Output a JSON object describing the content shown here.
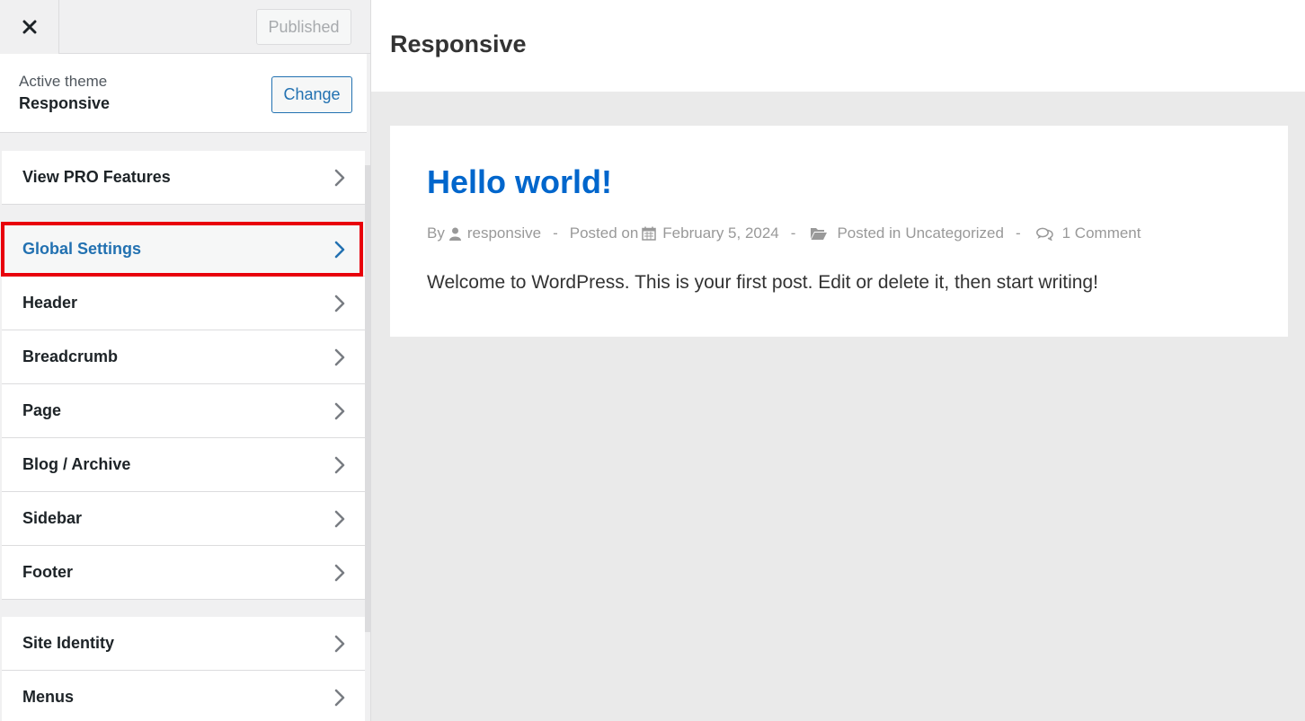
{
  "topbar": {
    "close_label": "×",
    "publish_label": "Published"
  },
  "theme": {
    "label": "Active theme",
    "name": "Responsive",
    "change_label": "Change"
  },
  "menu_group_1": [
    {
      "label": "View PRO Features"
    }
  ],
  "menu_group_2": [
    {
      "label": "Global Settings",
      "active": true
    },
    {
      "label": "Header"
    },
    {
      "label": "Breadcrumb"
    },
    {
      "label": "Page"
    },
    {
      "label": "Blog / Archive"
    },
    {
      "label": "Sidebar"
    },
    {
      "label": "Footer"
    }
  ],
  "menu_group_3": [
    {
      "label": "Site Identity"
    },
    {
      "label": "Menus"
    }
  ],
  "preview": {
    "site_title": "Responsive",
    "post": {
      "title": "Hello world!",
      "by_label": "By",
      "author": "responsive",
      "posted_on_label": "Posted on",
      "date": "February 5, 2024",
      "posted_in_label": "Posted in",
      "category": "Uncategorized",
      "comments": "1 Comment",
      "separator": "-",
      "excerpt": "Welcome to WordPress. This is your first post. Edit or delete it, then start writing!"
    }
  },
  "colors": {
    "accent": "#2271b1",
    "highlight": "#e8000b",
    "post_title": "#0066cc"
  }
}
